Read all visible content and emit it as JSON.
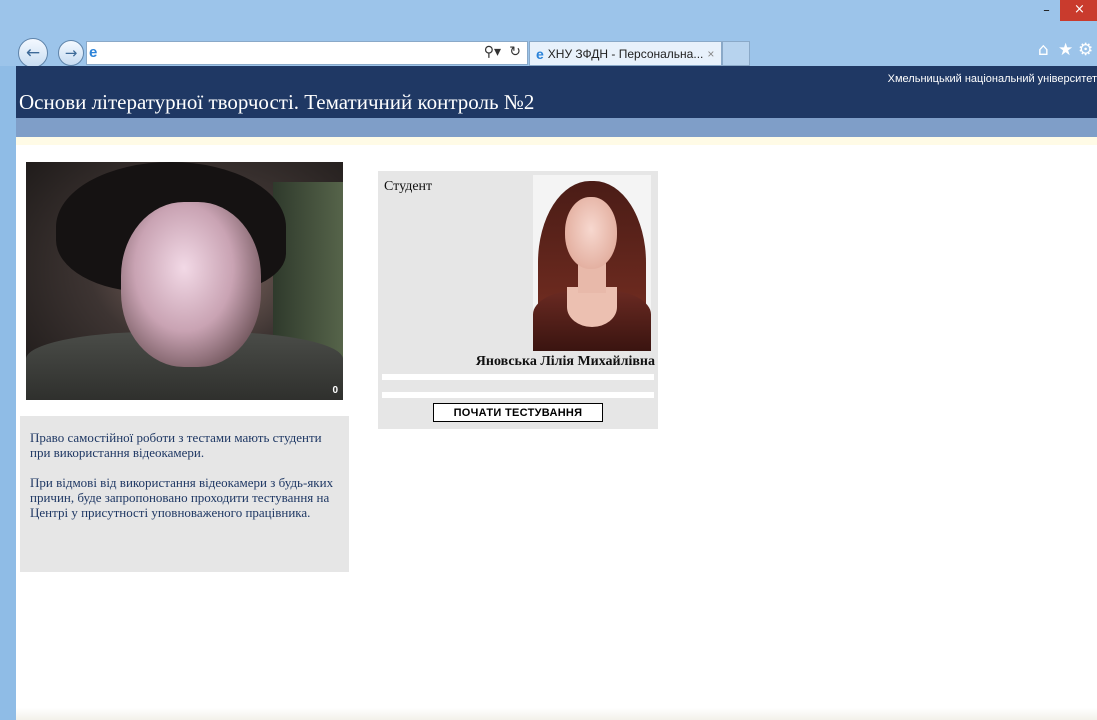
{
  "browser": {
    "address_value": "",
    "tab_label": "ХНУ ЗФДН - Персональна...",
    "tab_close": "×",
    "window_controls": {
      "minimize": "–",
      "maximize": "□",
      "close": "×"
    },
    "icons": [
      "back-icon",
      "forward-icon",
      "ie-logo-icon",
      "search-icon",
      "refresh-icon",
      "home-icon",
      "favorites-star-icon",
      "settings-gear-icon"
    ]
  },
  "header": {
    "university": "Хмельницький національний університет",
    "title": "Основи літературної творчості. Тематичний контроль №2",
    "banner_color": "#1f3864",
    "strip_color": "#7f9ec8"
  },
  "webcam": {
    "frame_counter": "0"
  },
  "notice": {
    "paragraph1": "Право самостійної роботи з тестами мають студенти при використання відеокамери.",
    "paragraph2": "При відмові від використання відеокамери з будь-яких причин, буде запропоновано проходити тестування на Центрі у присутності уповноваженого працівника."
  },
  "student": {
    "label": "Студент",
    "name": "Яновська Лілія Михайлівна",
    "start_button": "ПОЧАТИ ТЕСТУВАННЯ"
  }
}
